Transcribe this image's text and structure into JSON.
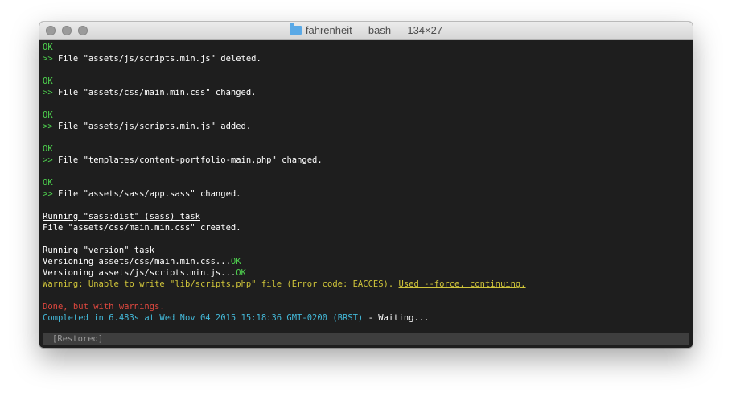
{
  "window": {
    "title": "fahrenheit — bash — 134×27"
  },
  "traffic_lights": [
    "close",
    "minimize",
    "zoom"
  ],
  "colors": {
    "ok": "#4ed04e",
    "warning": "#d0c53a",
    "error": "#e0483f",
    "info": "#43b8d8",
    "background": "#1e1e1e"
  },
  "terminal": {
    "lines": [
      [
        {
          "text": "OK",
          "style": "green"
        }
      ],
      [
        {
          "text": ">> ",
          "style": "green"
        },
        {
          "text": "File \"assets/js/scripts.min.js\" deleted.",
          "style": "white"
        }
      ],
      [],
      [
        {
          "text": "OK",
          "style": "green"
        }
      ],
      [
        {
          "text": ">> ",
          "style": "green"
        },
        {
          "text": "File \"assets/css/main.min.css\" changed.",
          "style": "white"
        }
      ],
      [],
      [
        {
          "text": "OK",
          "style": "green"
        }
      ],
      [
        {
          "text": ">> ",
          "style": "green"
        },
        {
          "text": "File \"assets/js/scripts.min.js\" added.",
          "style": "white"
        }
      ],
      [],
      [
        {
          "text": "OK",
          "style": "green"
        }
      ],
      [
        {
          "text": ">> ",
          "style": "green"
        },
        {
          "text": "File \"templates/content-portfolio-main.php\" changed.",
          "style": "white"
        }
      ],
      [],
      [
        {
          "text": "OK",
          "style": "green"
        }
      ],
      [
        {
          "text": ">> ",
          "style": "green"
        },
        {
          "text": "File \"assets/sass/app.sass\" changed.",
          "style": "white"
        }
      ],
      [],
      [
        {
          "text": "Running \"sass:dist\" (sass) task",
          "style": "white u"
        }
      ],
      [
        {
          "text": "File \"assets/css/main.min.css\" created.",
          "style": "white"
        }
      ],
      [],
      [
        {
          "text": "Running \"version\" task",
          "style": "white u"
        }
      ],
      [
        {
          "text": "Versioning assets/css/main.min.css...",
          "style": "white"
        },
        {
          "text": "OK",
          "style": "green"
        }
      ],
      [
        {
          "text": "Versioning assets/js/scripts.min.js...",
          "style": "white"
        },
        {
          "text": "OK",
          "style": "green"
        }
      ],
      [
        {
          "text": "Warning: Unable to write \"lib/scripts.php\" file (Error code: EACCES). ",
          "style": "yellow"
        },
        {
          "text": "Used --force, continuing.",
          "style": "yellow u"
        }
      ],
      [],
      [
        {
          "text": "Done, but with warnings.",
          "style": "red"
        }
      ],
      [
        {
          "text": "Completed in 6.483s at Wed Nov 04 2015 15:18:36 GMT-0200 (BRST)",
          "style": "cyan"
        },
        {
          "text": " - Waiting...",
          "style": "white"
        }
      ]
    ],
    "restored_label": "[Restored]"
  }
}
